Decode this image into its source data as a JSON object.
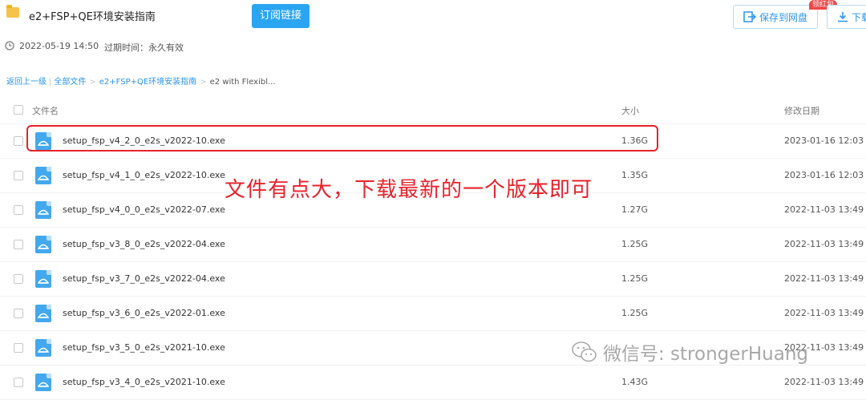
{
  "header": {
    "title": "e2+FSP+QE环境安装指南",
    "subscribe_label": "订阅链接",
    "save_label": "保存到网盘",
    "badge_label": "领红包",
    "download_label": "下载",
    "date": "2022-05-19 14:50",
    "expire_text": "过期时间：永久有效"
  },
  "breadcrumb": {
    "back": "返回上一级",
    "all_files": "全部文件",
    "folder": "e2+FSP+QE环境安装指南",
    "current": "e2 with Flexibl..."
  },
  "table": {
    "columns": {
      "name": "文件名",
      "size": "大小",
      "date": "修改日期"
    },
    "rows": [
      {
        "name": "setup_fsp_v4_2_0_e2s_v2022-10.exe",
        "size": "1.36G",
        "date": "2023-01-16 12:03"
      },
      {
        "name": "setup_fsp_v4_1_0_e2s_v2022-10.exe",
        "size": "1.35G",
        "date": "2023-01-16 12:03"
      },
      {
        "name": "setup_fsp_v4_0_0_e2s_v2022-07.exe",
        "size": "1.27G",
        "date": "2022-11-03 13:49"
      },
      {
        "name": "setup_fsp_v3_8_0_e2s_v2022-04.exe",
        "size": "1.25G",
        "date": "2022-11-03 13:49"
      },
      {
        "name": "setup_fsp_v3_7_0_e2s_v2022-04.exe",
        "size": "1.25G",
        "date": "2022-11-03 13:49"
      },
      {
        "name": "setup_fsp_v3_6_0_e2s_v2022-01.exe",
        "size": "1.25G",
        "date": "2022-11-03 13:49"
      },
      {
        "name": "setup_fsp_v3_5_0_e2s_v2021-10.exe",
        "size": "",
        "date": "2022-11-03 13:49"
      },
      {
        "name": "setup_fsp_v3_4_0_e2s_v2021-10.exe",
        "size": "1.43G",
        "date": "2022-11-03 13:49"
      }
    ]
  },
  "annotation": "文件有点大，下载最新的一个版本即可",
  "watermark": "微信号: strongerHuang",
  "colors": {
    "accent": "#2aa5f2",
    "highlight": "#e8222a",
    "link": "#2a94e8"
  }
}
